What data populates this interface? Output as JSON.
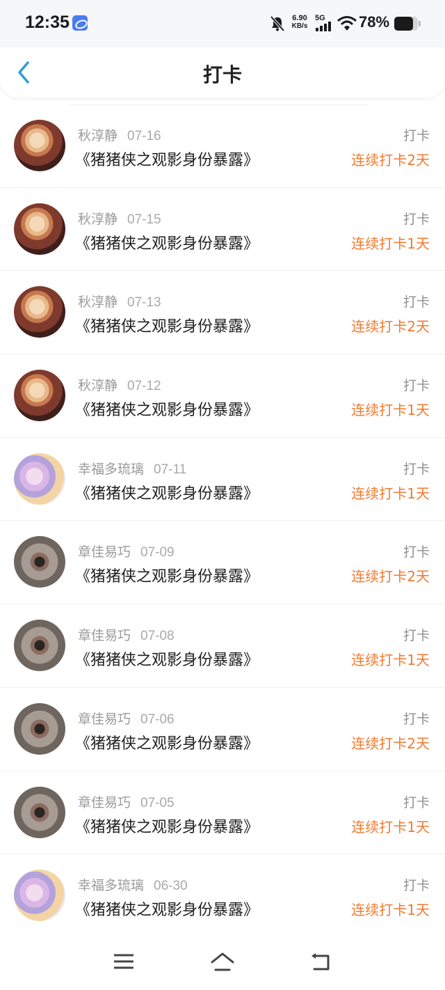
{
  "status_bar": {
    "time": "12:35",
    "net_speed_value": "6.90",
    "net_speed_unit": "KB/s",
    "network": "5G",
    "battery": "78%"
  },
  "header": {
    "title": "打卡"
  },
  "checkins": [
    {
      "user": "秋淳静",
      "date": "07-16",
      "book": "《猪猪侠之观影身份暴露》",
      "tag": "打卡",
      "streak": "连续打卡2天"
    },
    {
      "user": "秋淳静",
      "date": "07-15",
      "book": "《猪猪侠之观影身份暴露》",
      "tag": "打卡",
      "streak": "连续打卡1天"
    },
    {
      "user": "秋淳静",
      "date": "07-13",
      "book": "《猪猪侠之观影身份暴露》",
      "tag": "打卡",
      "streak": "连续打卡2天"
    },
    {
      "user": "秋淳静",
      "date": "07-12",
      "book": "《猪猪侠之观影身份暴露》",
      "tag": "打卡",
      "streak": "连续打卡1天"
    },
    {
      "user": "幸福多琉璃",
      "date": "07-11",
      "book": "《猪猪侠之观影身份暴露》",
      "tag": "打卡",
      "streak": "连续打卡1天"
    },
    {
      "user": "章佳易巧",
      "date": "07-09",
      "book": "《猪猪侠之观影身份暴露》",
      "tag": "打卡",
      "streak": "连续打卡2天"
    },
    {
      "user": "章佳易巧",
      "date": "07-08",
      "book": "《猪猪侠之观影身份暴露》",
      "tag": "打卡",
      "streak": "连续打卡1天"
    },
    {
      "user": "章佳易巧",
      "date": "07-06",
      "book": "《猪猪侠之观影身份暴露》",
      "tag": "打卡",
      "streak": "连续打卡2天"
    },
    {
      "user": "章佳易巧",
      "date": "07-05",
      "book": "《猪猪侠之观影身份暴露》",
      "tag": "打卡",
      "streak": "连续打卡1天"
    },
    {
      "user": "幸福多琉璃",
      "date": "06-30",
      "book": "《猪猪侠之观影身份暴露》",
      "tag": "打卡",
      "streak": "连续打卡1天"
    }
  ],
  "colors": {
    "accent": "#f07a30",
    "back_arrow": "#2d9cdb"
  }
}
